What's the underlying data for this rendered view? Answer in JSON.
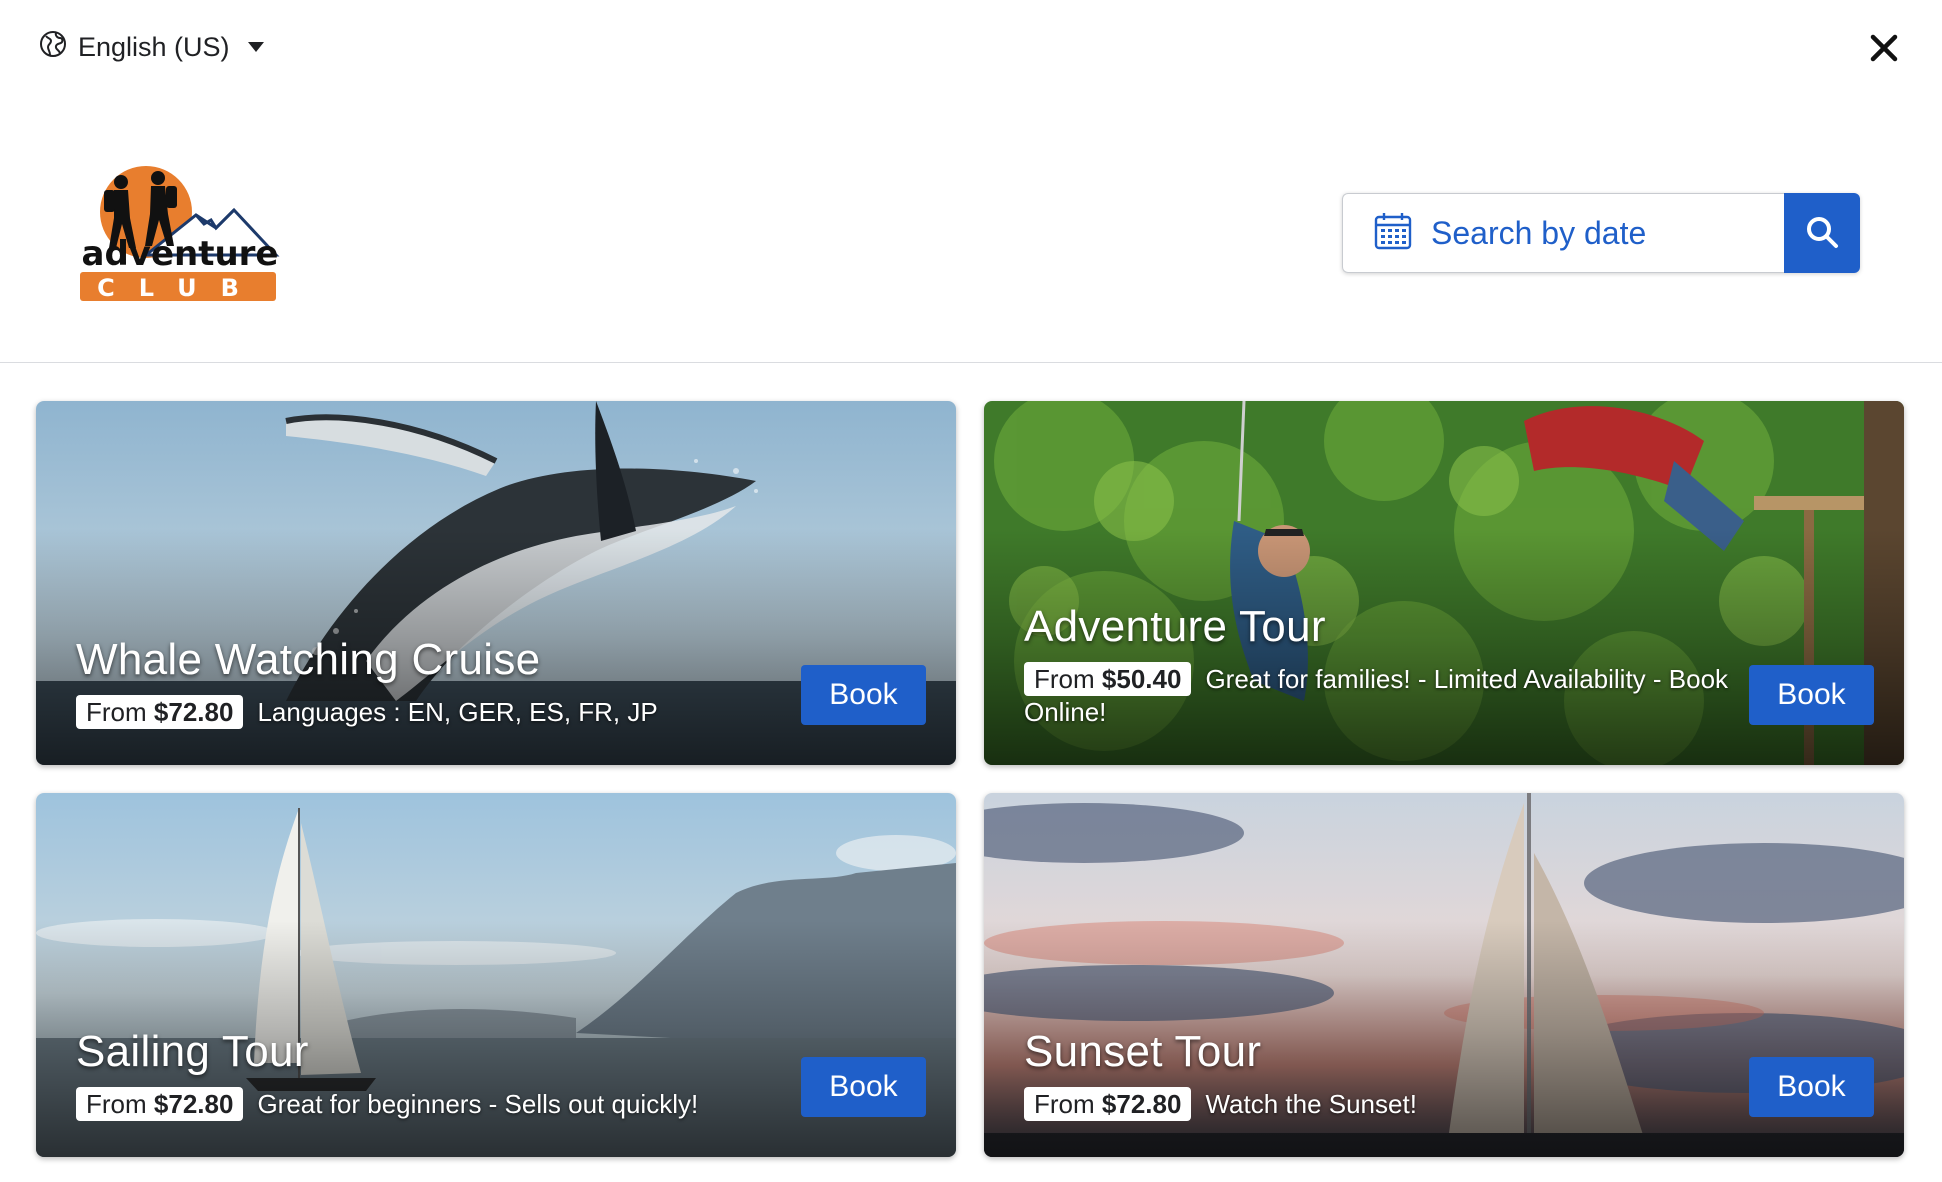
{
  "language": {
    "label": "English (US)",
    "icon": "globe-icon"
  },
  "close": {
    "icon": "close-icon"
  },
  "logo": {
    "line1": "adventure",
    "line2": "CLUB",
    "colors": {
      "sun": "#e87e2e",
      "mountain": "#1d3a6b",
      "text": "#111111"
    }
  },
  "search": {
    "placeholder": "Search by date",
    "icon": "calendar-icon",
    "button_icon": "search-icon"
  },
  "colors": {
    "accent": "#1f5fc9"
  },
  "tours": [
    {
      "title": "Whale Watching Cruise",
      "from": "From",
      "price": "$72.80",
      "desc": "Languages : EN, GER, ES, FR, JP",
      "button": "Book"
    },
    {
      "title": "Adventure Tour",
      "from": "From",
      "price": "$50.40",
      "desc": "Great for families! - Limited Availability - Book Online!",
      "button": "Book"
    },
    {
      "title": "Sailing Tour",
      "from": "From",
      "price": "$72.80",
      "desc": "Great for beginners - Sells out quickly!",
      "button": "Book"
    },
    {
      "title": "Sunset Tour",
      "from": "From",
      "price": "$72.80",
      "desc": "Watch the Sunset!",
      "button": "Book"
    }
  ]
}
